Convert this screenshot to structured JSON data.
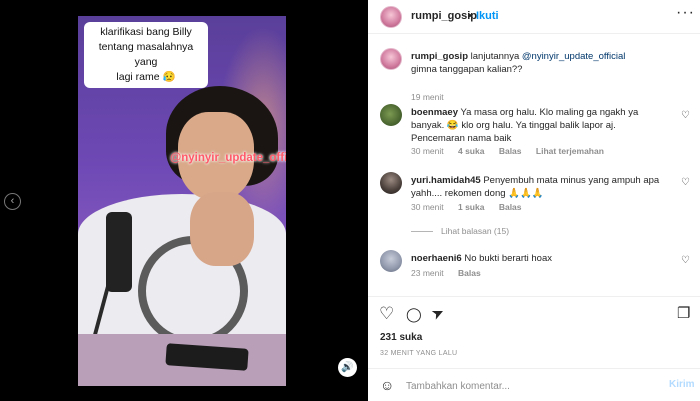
{
  "media": {
    "caption_lines": [
      "klarifikasi bang Billy",
      "tentang masalahnya yang",
      "lagi rame 😥"
    ],
    "watermark": "@nyinyir_update_official",
    "carousel_dots": 3,
    "active_dot": 2,
    "prev_icon": "‹",
    "sound_icon": "🔊"
  },
  "header": {
    "username": "rumpi_gosip",
    "separator": "•",
    "follow_label": "Ikuti",
    "more_icon": "···"
  },
  "caption_post": {
    "username": "rumpi_gosip",
    "text_before": " lanjutannya ",
    "mention": "@nyinyir_update_official",
    "line2": "gimna tanggapan kalian??",
    "time": "19 menit"
  },
  "comments": [
    {
      "username": "boenmaey",
      "text": " Ya masa org halu. Klo maling ga ngakh ya banyak. 😂 klo org halu. Ya tinggal balik lapor aj. Pencemaran nama baik",
      "time": "30 menit",
      "likes": "4 suka",
      "reply": "Balas",
      "translate": "Lihat terjemahan"
    },
    {
      "username": "yuri.hamidah45",
      "text": " Penyembuh mata minus yang ampuh apa yahh.... rekomen dong 🙏🙏🙏",
      "time": "30 menit",
      "likes": "1 suka",
      "reply": "Balas",
      "view_replies": "Lihat balasan (15)"
    },
    {
      "username": "noerhaeni6",
      "text": " No bukti berarti hoax",
      "time": "23 menit",
      "likes": "",
      "reply": "Balas"
    }
  ],
  "actions": {
    "like_icon": "♡",
    "comment_icon": "◯",
    "share_icon": "➤",
    "save_icon": "❐"
  },
  "likes": "231 suka",
  "post_time": "32 MENIT YANG LALU",
  "add_comment": {
    "emoji_icon": "☺",
    "placeholder": "Tambahkan komentar...",
    "post_label": "Kirim"
  },
  "comment_heart_icon": "♡",
  "colors": {
    "accent": "#0095f6",
    "muted": "#8e8e8e",
    "text": "#262626",
    "watermark": "#ff5a6a"
  }
}
